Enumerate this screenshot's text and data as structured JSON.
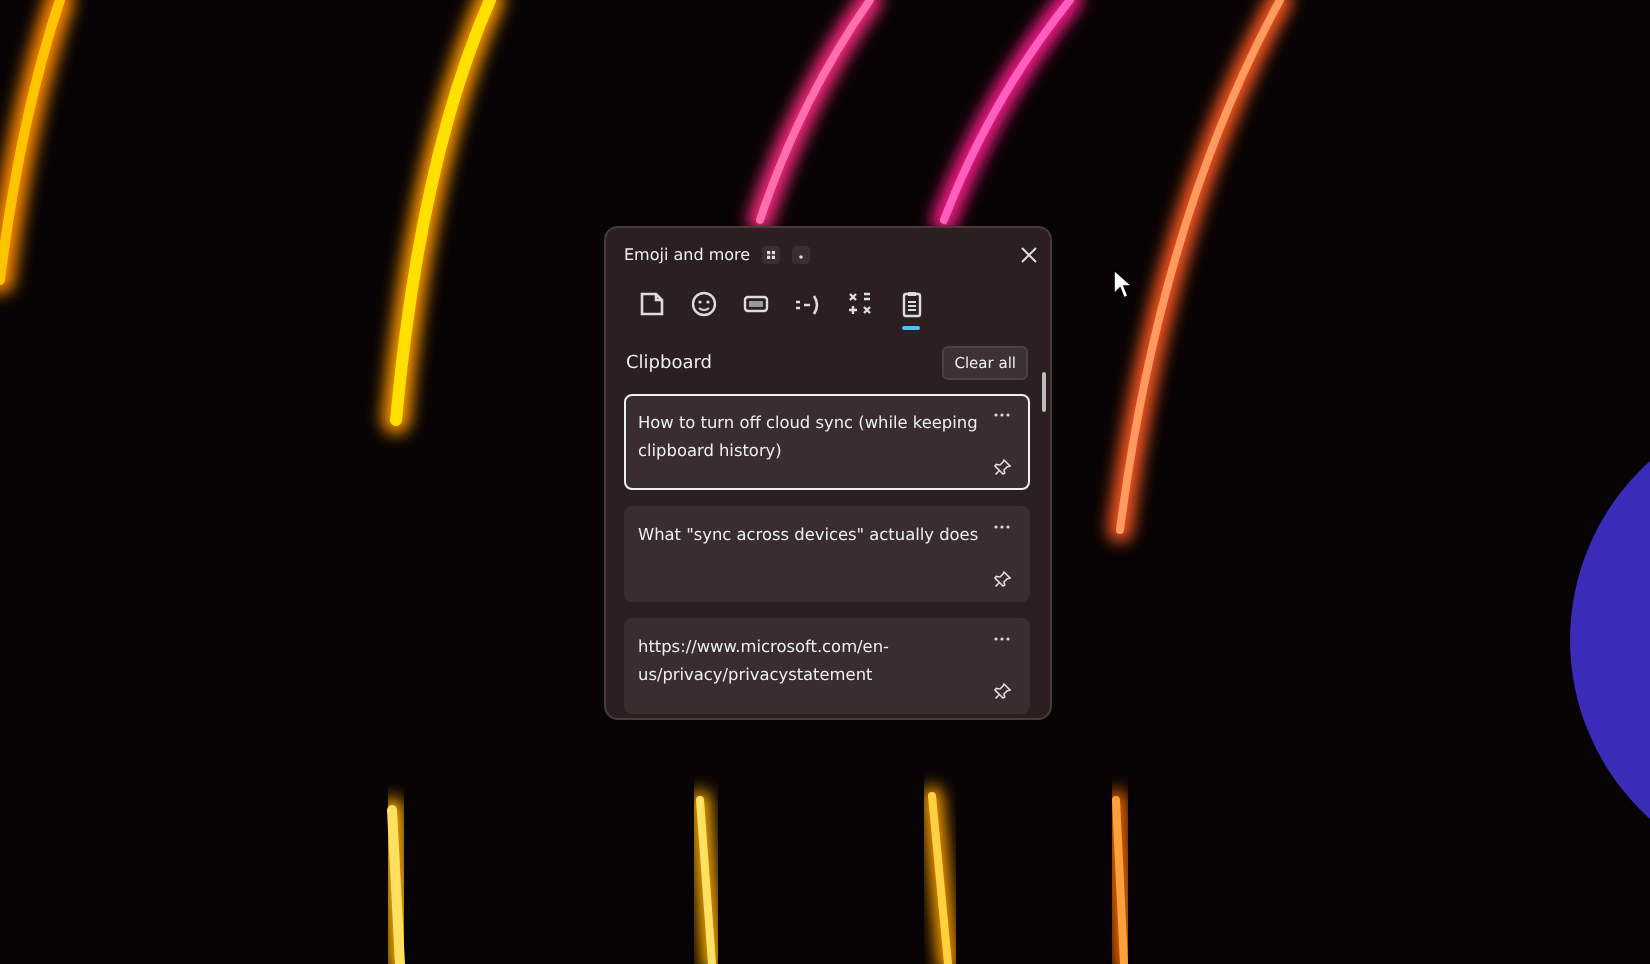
{
  "window": {
    "title": "Emoji and more"
  },
  "tabs": [
    {
      "kind": "sticker",
      "selected": false
    },
    {
      "kind": "emoji",
      "selected": false
    },
    {
      "kind": "gif",
      "selected": false
    },
    {
      "kind": "kaomoji",
      "selected": false
    },
    {
      "kind": "symbols",
      "selected": false
    },
    {
      "kind": "clipboard",
      "selected": true
    }
  ],
  "section": {
    "title": "Clipboard",
    "clear_button": "Clear all"
  },
  "items": [
    {
      "text": "How to turn off cloud sync (while keeping clipboard history)",
      "selected": true
    },
    {
      "text": "What \"sync across devices\" actually does",
      "selected": false
    },
    {
      "text": "https://www.microsoft.com/en-us/privacy/privacystatement",
      "selected": false
    }
  ]
}
